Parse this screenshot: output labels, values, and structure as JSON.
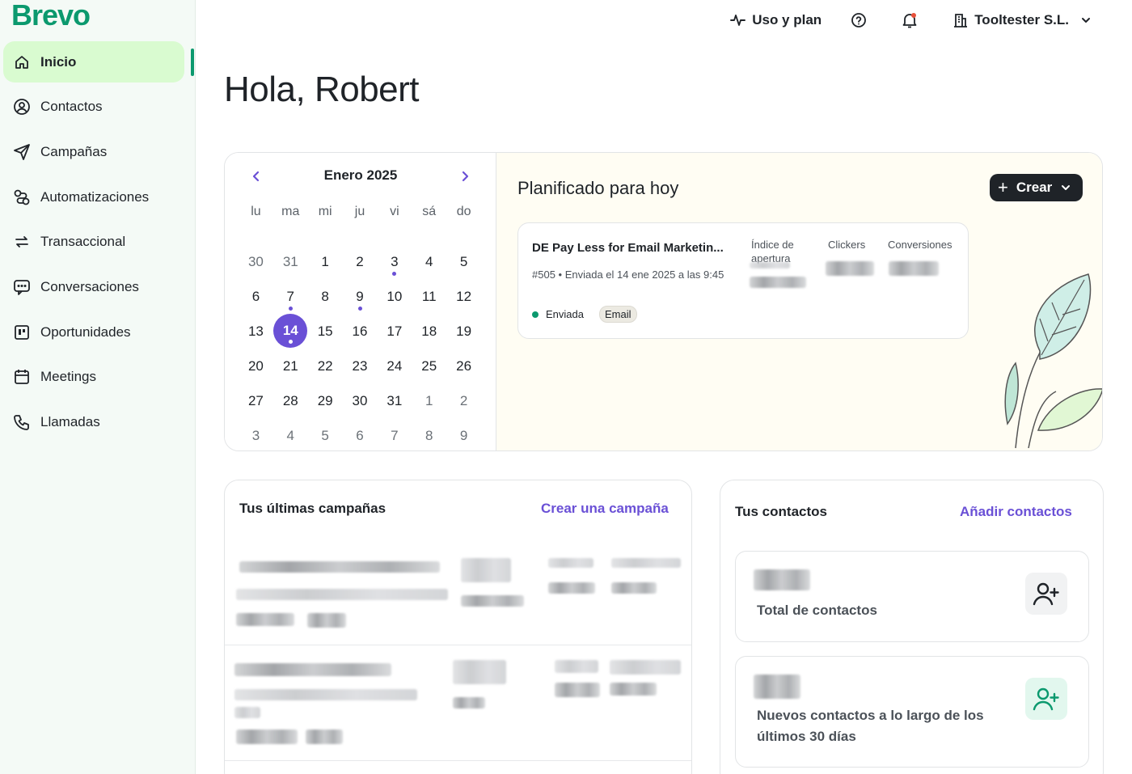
{
  "brand": {
    "logo": "Brevo",
    "accent": "#0b996e",
    "purple": "#6a50d6"
  },
  "sidebar": {
    "items": [
      {
        "label": "Inicio",
        "icon": "home-icon",
        "active": true
      },
      {
        "label": "Contactos",
        "icon": "contacts-icon"
      },
      {
        "label": "Campañas",
        "icon": "send-icon"
      },
      {
        "label": "Automatizaciones",
        "icon": "automation-icon"
      },
      {
        "label": "Transaccional",
        "icon": "arrows-icon"
      },
      {
        "label": "Conversaciones",
        "icon": "chat-icon"
      },
      {
        "label": "Oportunidades",
        "icon": "kanban-icon"
      },
      {
        "label": "Meetings",
        "icon": "calendar-icon"
      },
      {
        "label": "Llamadas",
        "icon": "phone-icon"
      }
    ]
  },
  "topbar": {
    "usage_label": "Uso y plan",
    "company_label": "Tooltester S.L."
  },
  "greeting": "Hola, Robert",
  "calendar": {
    "month_label": "Enero 2025",
    "weekdays": [
      "lu",
      "ma",
      "mi",
      "ju",
      "vi",
      "sá",
      "do"
    ],
    "weeks": [
      [
        {
          "d": "30",
          "m": true
        },
        {
          "d": "31",
          "m": true
        },
        {
          "d": "1"
        },
        {
          "d": "2"
        },
        {
          "d": "3",
          "dot": true
        },
        {
          "d": "4"
        },
        {
          "d": "5"
        }
      ],
      [
        {
          "d": "6"
        },
        {
          "d": "7",
          "dot": true
        },
        {
          "d": "8"
        },
        {
          "d": "9",
          "dot": true
        },
        {
          "d": "10"
        },
        {
          "d": "11"
        },
        {
          "d": "12"
        }
      ],
      [
        {
          "d": "13"
        },
        {
          "d": "14",
          "sel": true,
          "dot": true
        },
        {
          "d": "15"
        },
        {
          "d": "16"
        },
        {
          "d": "17"
        },
        {
          "d": "18"
        },
        {
          "d": "19"
        }
      ],
      [
        {
          "d": "20"
        },
        {
          "d": "21"
        },
        {
          "d": "22"
        },
        {
          "d": "23"
        },
        {
          "d": "24"
        },
        {
          "d": "25"
        },
        {
          "d": "26"
        }
      ],
      [
        {
          "d": "27"
        },
        {
          "d": "28"
        },
        {
          "d": "29"
        },
        {
          "d": "30"
        },
        {
          "d": "31"
        },
        {
          "d": "1",
          "m": true
        },
        {
          "d": "2",
          "m": true
        }
      ],
      [
        {
          "d": "3",
          "m": true
        },
        {
          "d": "4",
          "m": true
        },
        {
          "d": "5",
          "m": true
        },
        {
          "d": "6",
          "m": true
        },
        {
          "d": "7",
          "m": true
        },
        {
          "d": "8",
          "m": true
        },
        {
          "d": "9",
          "m": true
        }
      ]
    ]
  },
  "plan": {
    "title": "Planificado para hoy",
    "create_label": "Crear",
    "campaign": {
      "name": "DE Pay Less for Email Marketin...",
      "meta": "#505 • Enviada el 14 ene 2025 a las 9:45",
      "status": "Enviada",
      "tag": "Email",
      "metrics": [
        "Índice de apertura",
        "Clickers",
        "Conversiones"
      ]
    }
  },
  "campaigns": {
    "title": "Tus últimas campañas",
    "link": "Crear una campaña"
  },
  "contacts": {
    "title": "Tus contactos",
    "link": "Añadir contactos",
    "total_label": "Total de contactos",
    "new_label": "Nuevos contactos a lo largo de los últimos 30 días"
  }
}
